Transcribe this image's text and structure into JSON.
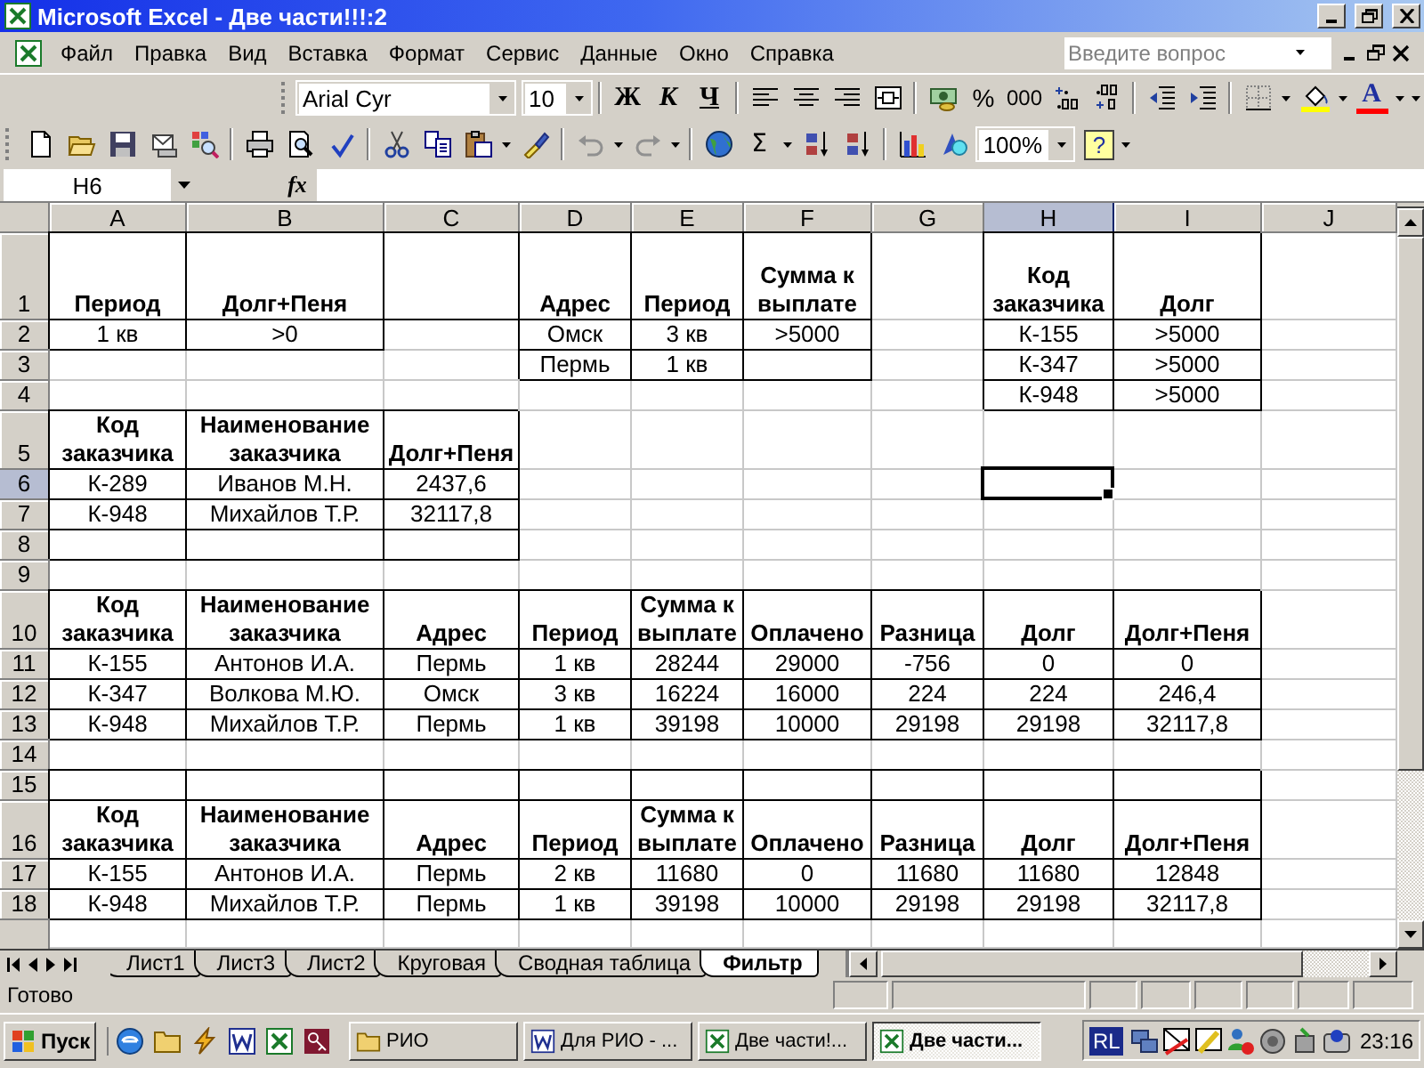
{
  "window": {
    "title": "Microsoft Excel - Две части!!!:2"
  },
  "menu": [
    {
      "label": "Файл"
    },
    {
      "label": "Правка"
    },
    {
      "label": "Вид"
    },
    {
      "label": "Вставка"
    },
    {
      "label": "Формат"
    },
    {
      "label": "Сервис"
    },
    {
      "label": "Данные"
    },
    {
      "label": "Окно"
    },
    {
      "label": "Справка"
    }
  ],
  "help_box": {
    "placeholder": "Введите вопрос"
  },
  "formatting_toolbar": {
    "font": "Arial Cyr",
    "size": "10",
    "bold": "Ж",
    "italic": "К",
    "underline": "Ч",
    "percent": "%",
    "thousands": "000",
    "font_color": "A"
  },
  "standard_toolbar": {
    "undo": {
      "disabled": true
    },
    "redo": {
      "disabled": true
    },
    "sum": "Σ",
    "zoom": "100%",
    "help": "?"
  },
  "formula_bar": {
    "name_box": "H6",
    "fx": "fx"
  },
  "sheet": {
    "columns": [
      {
        "label": "A",
        "selected": false
      },
      {
        "label": "B",
        "selected": false
      },
      {
        "label": "C",
        "selected": false
      },
      {
        "label": "D",
        "selected": false
      },
      {
        "label": "E",
        "selected": false
      },
      {
        "label": "F",
        "selected": false
      },
      {
        "label": "G",
        "selected": false
      },
      {
        "label": "H",
        "selected": true
      },
      {
        "label": "I",
        "selected": false
      },
      {
        "label": "J",
        "selected": false
      }
    ],
    "rows": [
      {
        "label": "1",
        "selected": false,
        "cells": [
          {
            "text": "Период",
            "kind": "header",
            "bordered": true
          },
          {
            "text": "Долг+Пеня",
            "kind": "header",
            "bordered": true
          },
          {
            "bordered": true
          },
          {
            "text": "Адрес",
            "kind": "header",
            "bordered": true
          },
          {
            "text": "Период",
            "kind": "header",
            "bordered": true
          },
          {
            "text": "Сумма к выплате",
            "kind": "header",
            "bordered": true
          },
          null,
          {
            "text": "Код заказчика",
            "kind": "header",
            "bordered": true
          },
          {
            "text": "Долг",
            "kind": "header",
            "bordered": true
          },
          null
        ]
      },
      {
        "label": "2",
        "selected": false,
        "cells": [
          {
            "text": "1 кв",
            "kind": "value",
            "bordered": true
          },
          {
            "text": ">0",
            "kind": "value",
            "bordered": true
          },
          null,
          {
            "text": "Омск",
            "kind": "value",
            "bordered": true
          },
          {
            "text": "3 кв",
            "kind": "value",
            "bordered": true
          },
          {
            "text": ">5000",
            "kind": "value",
            "bordered": true
          },
          null,
          {
            "text": "К-155",
            "kind": "value",
            "bordered": true
          },
          {
            "text": ">5000",
            "kind": "value",
            "bordered": true
          },
          null
        ]
      },
      {
        "label": "3",
        "selected": false,
        "cells": [
          null,
          null,
          null,
          {
            "text": "Пермь",
            "kind": "value",
            "bordered": true
          },
          {
            "text": "1 кв",
            "kind": "value",
            "bordered": true
          },
          {
            "bordered": true
          },
          null,
          {
            "text": "К-347",
            "kind": "value",
            "bordered": true
          },
          {
            "text": ">5000",
            "kind": "value",
            "bordered": true
          },
          null
        ]
      },
      {
        "label": "4",
        "selected": false,
        "cells": [
          null,
          null,
          null,
          null,
          null,
          null,
          null,
          {
            "text": "К-948",
            "kind": "value",
            "bordered": true
          },
          {
            "text": ">5000",
            "kind": "value",
            "bordered": true
          },
          null
        ]
      },
      {
        "label": "5",
        "selected": false,
        "cells": [
          {
            "text": "Код заказчика",
            "kind": "header",
            "bordered": true
          },
          {
            "text": "Наименование заказчика",
            "kind": "header",
            "bordered": true
          },
          {
            "text": "Долг+Пеня",
            "kind": "header",
            "bordered": true
          },
          null,
          null,
          null,
          null,
          null,
          null,
          null
        ]
      },
      {
        "label": "6",
        "selected": true,
        "cells": [
          {
            "text": "К-289",
            "kind": "value",
            "bordered": true
          },
          {
            "text": "Иванов М.Н.",
            "kind": "value",
            "bordered": true
          },
          {
            "text": "2437,6",
            "kind": "value",
            "bordered": true
          },
          null,
          null,
          null,
          null,
          null,
          null,
          null
        ]
      },
      {
        "label": "7",
        "selected": false,
        "cells": [
          {
            "text": "К-948",
            "kind": "value",
            "bordered": true
          },
          {
            "text": "Михайлов Т.Р.",
            "kind": "value",
            "bordered": true
          },
          {
            "text": "32117,8",
            "kind": "value",
            "bordered": true
          },
          null,
          null,
          null,
          null,
          null,
          null,
          null
        ]
      },
      {
        "label": "8",
        "selected": false,
        "cells": [
          {
            "bordered": true
          },
          {
            "bordered": true
          },
          {
            "bordered": true
          },
          null,
          null,
          null,
          null,
          null,
          null,
          null
        ]
      },
      {
        "label": "9",
        "selected": false,
        "cells": [
          null,
          null,
          null,
          null,
          null,
          null,
          null,
          null,
          null,
          null
        ]
      },
      {
        "label": "10",
        "selected": false,
        "cells": [
          {
            "text": "Код заказчика",
            "kind": "header",
            "bordered": true
          },
          {
            "text": "Наименование заказчика",
            "kind": "header",
            "bordered": true
          },
          {
            "text": "Адрес",
            "kind": "header",
            "bordered": true
          },
          {
            "text": "Период",
            "kind": "header",
            "bordered": true
          },
          {
            "text": "Сумма к выплате",
            "kind": "header",
            "bordered": true
          },
          {
            "text": "Оплачено",
            "kind": "header",
            "bordered": true
          },
          {
            "text": "Разница",
            "kind": "header",
            "bordered": true
          },
          {
            "text": "Долг",
            "kind": "header",
            "bordered": true
          },
          {
            "text": "Долг+Пеня",
            "kind": "header",
            "bordered": true
          },
          null
        ]
      },
      {
        "label": "11",
        "selected": false,
        "cells": [
          {
            "text": "К-155",
            "kind": "value",
            "bordered": true
          },
          {
            "text": "Антонов И.А.",
            "kind": "value",
            "bordered": true
          },
          {
            "text": "Пермь",
            "kind": "value",
            "bordered": true
          },
          {
            "text": "1 кв",
            "kind": "value",
            "bordered": true
          },
          {
            "text": "28244",
            "kind": "value",
            "bordered": true
          },
          {
            "text": "29000",
            "kind": "value",
            "bordered": true
          },
          {
            "text": "-756",
            "kind": "value",
            "bordered": true
          },
          {
            "text": "0",
            "kind": "value",
            "bordered": true
          },
          {
            "text": "0",
            "kind": "value",
            "bordered": true
          },
          null
        ]
      },
      {
        "label": "12",
        "selected": false,
        "cells": [
          {
            "text": "К-347",
            "kind": "value",
            "bordered": true
          },
          {
            "text": "Волкова М.Ю.",
            "kind": "value",
            "bordered": true
          },
          {
            "text": "Омск",
            "kind": "value",
            "bordered": true
          },
          {
            "text": "3 кв",
            "kind": "value",
            "bordered": true
          },
          {
            "text": "16224",
            "kind": "value",
            "bordered": true
          },
          {
            "text": "16000",
            "kind": "value",
            "bordered": true
          },
          {
            "text": "224",
            "kind": "value",
            "bordered": true
          },
          {
            "text": "224",
            "kind": "value",
            "bordered": true
          },
          {
            "text": "246,4",
            "kind": "value",
            "bordered": true
          },
          null
        ]
      },
      {
        "label": "13",
        "selected": false,
        "cells": [
          {
            "text": "К-948",
            "kind": "value",
            "bordered": true
          },
          {
            "text": "Михайлов Т.Р.",
            "kind": "value",
            "bordered": true
          },
          {
            "text": "Пермь",
            "kind": "value",
            "bordered": true
          },
          {
            "text": "1 кв",
            "kind": "value",
            "bordered": true
          },
          {
            "text": "39198",
            "kind": "value",
            "bordered": true
          },
          {
            "text": "10000",
            "kind": "value",
            "bordered": true
          },
          {
            "text": "29198",
            "kind": "value",
            "bordered": true
          },
          {
            "text": "29198",
            "kind": "value",
            "bordered": true
          },
          {
            "text": "32117,8",
            "kind": "value",
            "bordered": true
          },
          null
        ]
      },
      {
        "label": "14",
        "selected": false,
        "cells": [
          null,
          null,
          null,
          null,
          null,
          null,
          null,
          null,
          null,
          null
        ]
      },
      {
        "label": "15",
        "selected": false,
        "cells": [
          {
            "bordered": true
          },
          {
            "bordered": true
          },
          {
            "bordered": true
          },
          {
            "bordered": true
          },
          {
            "bordered": true
          },
          {
            "bordered": true
          },
          {
            "bordered": true
          },
          {
            "bordered": true
          },
          {
            "bordered": true
          },
          null
        ]
      },
      {
        "label": "16",
        "selected": false,
        "cells": [
          {
            "text": "Код заказчика",
            "kind": "header",
            "bordered": true
          },
          {
            "text": "Наименование заказчика",
            "kind": "header",
            "bordered": true
          },
          {
            "text": "Адрес",
            "kind": "header",
            "bordered": true
          },
          {
            "text": "Период",
            "kind": "header",
            "bordered": true
          },
          {
            "text": "Сумма к выплате",
            "kind": "header",
            "bordered": true
          },
          {
            "text": "Оплачено",
            "kind": "header",
            "bordered": true
          },
          {
            "text": "Разница",
            "kind": "header",
            "bordered": true
          },
          {
            "text": "Долг",
            "kind": "header",
            "bordered": true
          },
          {
            "text": "Долг+Пеня",
            "kind": "header",
            "bordered": true
          },
          null
        ]
      },
      {
        "label": "17",
        "selected": false,
        "cells": [
          {
            "text": "К-155",
            "kind": "value",
            "bordered": true
          },
          {
            "text": "Антонов И.А.",
            "kind": "value",
            "bordered": true
          },
          {
            "text": "Пермь",
            "kind": "value",
            "bordered": true
          },
          {
            "text": "2 кв",
            "kind": "value",
            "bordered": true
          },
          {
            "text": "11680",
            "kind": "value",
            "bordered": true
          },
          {
            "text": "0",
            "kind": "value",
            "bordered": true
          },
          {
            "text": "11680",
            "kind": "value",
            "bordered": true
          },
          {
            "text": "11680",
            "kind": "value",
            "bordered": true
          },
          {
            "text": "12848",
            "kind": "value",
            "bordered": true
          },
          null
        ]
      },
      {
        "label": "18",
        "selected": false,
        "cells": [
          {
            "text": "К-948",
            "kind": "value",
            "bordered": true
          },
          {
            "text": "Михайлов Т.Р.",
            "kind": "value",
            "bordered": true
          },
          {
            "text": "Пермь",
            "kind": "value",
            "bordered": true
          },
          {
            "text": "1 кв",
            "kind": "value",
            "bordered": true
          },
          {
            "text": "39198",
            "kind": "value",
            "bordered": true
          },
          {
            "text": "10000",
            "kind": "value",
            "bordered": true
          },
          {
            "text": "29198",
            "kind": "value",
            "bordered": true
          },
          {
            "text": "29198",
            "kind": "value",
            "bordered": true
          },
          {
            "text": "32117,8",
            "kind": "value",
            "bordered": true
          },
          null
        ]
      }
    ]
  },
  "sheet_tabs": [
    {
      "label": "Лист1",
      "selected": false
    },
    {
      "label": "Лист3",
      "selected": false
    },
    {
      "label": "Лист2",
      "selected": false
    },
    {
      "label": "Круговая",
      "selected": false
    },
    {
      "label": "Сводная таблица",
      "selected": false
    },
    {
      "label": "Фильтр",
      "selected": true
    }
  ],
  "status_bar": {
    "text": "Готово"
  },
  "taskbar": {
    "start": "Пуск",
    "tasks": [
      {
        "label": "РИО",
        "kind": "folder",
        "selected": false
      },
      {
        "label": "Для РИО - ...",
        "kind": "word",
        "selected": false
      },
      {
        "label": "Две части!...",
        "kind": "excel",
        "selected": false
      },
      {
        "label": "Две части...",
        "kind": "excel",
        "selected": true
      }
    ],
    "language": "RL",
    "clock": "23:16"
  }
}
